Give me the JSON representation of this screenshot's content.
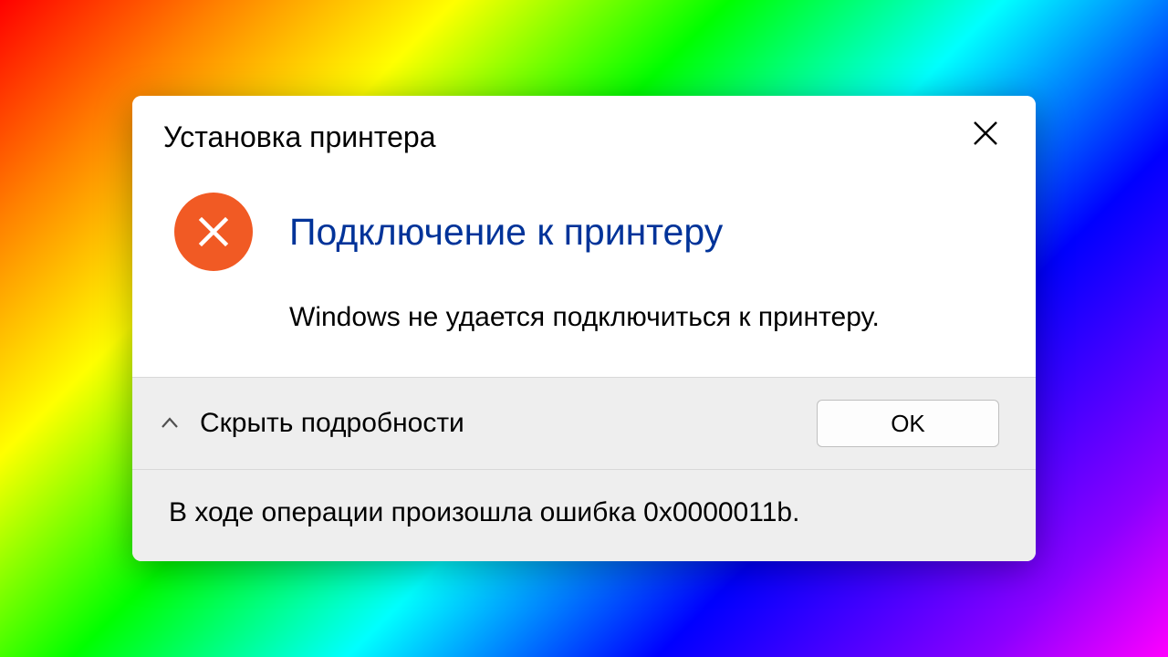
{
  "dialog": {
    "title": "Установка принтера",
    "heading": "Подключение к принтеру",
    "body": "Windows не удается подключиться к принтеру.",
    "details_toggle_label": "Скрыть подробности",
    "ok_label": "OK",
    "details_text": "В ходе операции произошла ошибка 0x0000011b."
  }
}
